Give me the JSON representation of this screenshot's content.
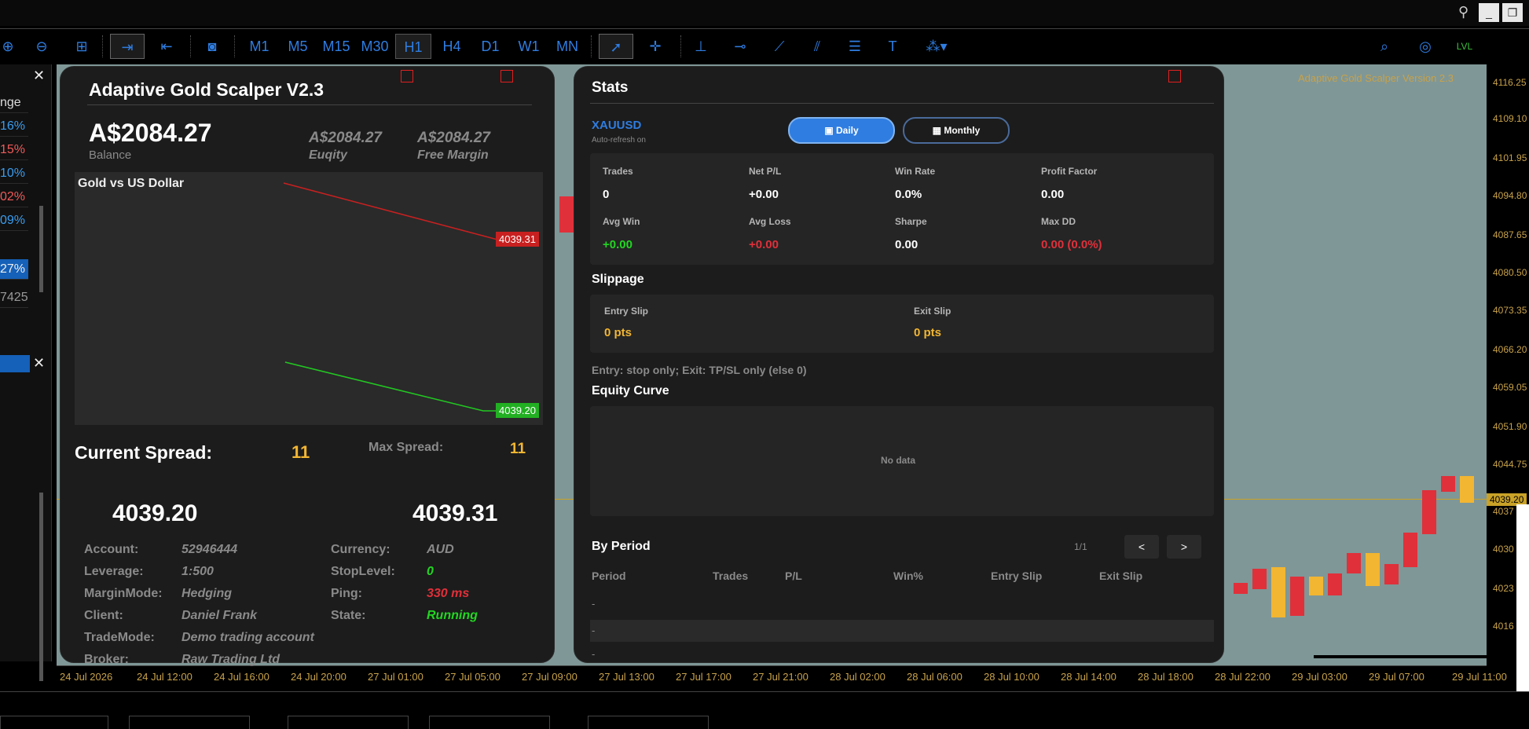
{
  "window": {
    "controls": [
      "_",
      "❐",
      "□"
    ]
  },
  "toolbar": {
    "timeframes": [
      "M1",
      "M5",
      "M15",
      "M30",
      "H1",
      "H4",
      "D1",
      "W1",
      "MN"
    ],
    "active_timeframe": "H1"
  },
  "left_panel": {
    "rows": [
      "nge",
      "16%",
      "15%",
      "10%",
      "02%",
      "09%",
      "27%",
      "7425"
    ]
  },
  "price_axis": {
    "labels": [
      "4116.25",
      "4109.10",
      "4101.95",
      "4094.80",
      "4087.65",
      "4080.50",
      "4073.35",
      "4066.20",
      "4059.05",
      "4051.90",
      "4044.75",
      "4039.20",
      "4037",
      "4030",
      "4023",
      "4016"
    ]
  },
  "time_axis": {
    "labels": [
      "24 Jul 2026",
      "24 Jul 12:00",
      "24 Jul 16:00",
      "24 Jul 20:00",
      "27 Jul 01:00",
      "27 Jul 05:00",
      "27 Jul 09:00",
      "27 Jul 13:00",
      "27 Jul 17:00",
      "27 Jul 21:00",
      "28 Jul 02:00",
      "28 Jul 06:00",
      "28 Jul 10:00",
      "28 Jul 14:00",
      "28 Jul 18:00",
      "28 Jul 22:00",
      "29 Jul 03:00",
      "29 Jul 07:00",
      "29 Jul 11:00"
    ]
  },
  "chart_overlay_title": "Adaptive Gold Scalper Version 2.3",
  "ea": {
    "title": "Adaptive Gold Scalper V2.3",
    "balance": "A$2084.27",
    "balance_label": "Balance",
    "equity": "A$2084.27",
    "equity_label": "Euqity",
    "free_margin": "A$2084.27",
    "free_margin_label": "Free Margin",
    "mini_chart_title": "Gold vs US Dollar",
    "ask": "4039.31",
    "bid": "4039.20",
    "spread_label": "Current Spread:",
    "spread_value": "11",
    "max_spread_label": "Max Spread:",
    "max_spread_value": "11",
    "price_bid": "4039.20",
    "price_ask": "4039.31",
    "info": [
      {
        "k": "Account:",
        "v": "52946444"
      },
      {
        "k": "Leverage:",
        "v": "1:500"
      },
      {
        "k": "MarginMode:",
        "v": "Hedging"
      },
      {
        "k": "Client:",
        "v": "Daniel Frank"
      },
      {
        "k": "TradeMode:",
        "v": "Demo trading account"
      },
      {
        "k": "Broker:",
        "v": "Raw Trading Ltd"
      }
    ],
    "info2": [
      {
        "k": "Currency:",
        "v": "AUD"
      },
      {
        "k": "StopLevel:",
        "v": "0"
      },
      {
        "k": "Ping:",
        "v": "330 ms"
      },
      {
        "k": "State:",
        "v": "Running"
      }
    ],
    "colors": {
      "red": "#e0303a",
      "green": "#22d622",
      "gold": "#f2b632"
    }
  },
  "stats": {
    "title": "Stats",
    "symbol": "XAUUSD",
    "auto_refresh": "Auto-refresh on",
    "daily_label": "Daily",
    "monthly_label": "Monthly",
    "metrics": [
      {
        "k": "Trades",
        "v": "0"
      },
      {
        "k": "Net P/L",
        "v": "+0.00"
      },
      {
        "k": "Win Rate",
        "v": "0.0%"
      },
      {
        "k": "Profit Factor",
        "v": "0.00"
      },
      {
        "k": "Avg Win",
        "v": "+0.00"
      },
      {
        "k": "Avg Loss",
        "v": "+0.00"
      },
      {
        "k": "Sharpe",
        "v": "0.00"
      },
      {
        "k": "Max DD",
        "v": "0.00 (0.0%)"
      }
    ],
    "slippage_title": "Slippage",
    "entry_slip_label": "Entry Slip",
    "entry_slip": "0 pts",
    "exit_slip_label": "Exit Slip",
    "exit_slip": "0 pts",
    "slip_note": "Entry: stop only; Exit: TP/SL only (else 0)",
    "equity_title": "Equity Curve",
    "no_data": "No data",
    "period_title": "By Period",
    "page": "1/1",
    "prev": "<",
    "next": ">",
    "columns": [
      "Period",
      "Trades",
      "P/L",
      "Win%",
      "Entry Slip",
      "Exit Slip"
    ],
    "rows": [
      "-",
      "-",
      "-"
    ]
  }
}
